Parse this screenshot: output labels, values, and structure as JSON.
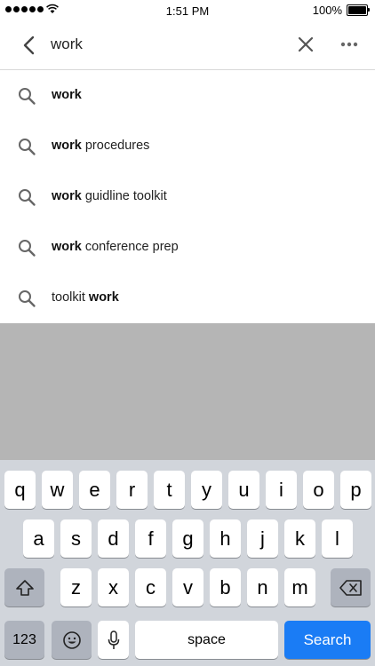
{
  "status": {
    "time": "1:51 PM",
    "battery": "100%"
  },
  "search": {
    "value": "work",
    "placeholder": ""
  },
  "icons": {
    "back": "chevron-left-icon",
    "clear": "close-icon",
    "more": "more-horizontal-icon",
    "suggestion": "search-icon"
  },
  "suggestions": [
    {
      "bold_pre": "work",
      "rest": "",
      "bold_post": ""
    },
    {
      "bold_pre": "work",
      "rest": " procedures",
      "bold_post": ""
    },
    {
      "bold_pre": "work",
      "rest": " guidline toolkit",
      "bold_post": ""
    },
    {
      "bold_pre": "work",
      "rest": " conference prep",
      "bold_post": ""
    },
    {
      "bold_pre": "",
      "rest": "toolkit ",
      "bold_post": "work"
    }
  ],
  "keyboard": {
    "row1": [
      "q",
      "w",
      "e",
      "r",
      "t",
      "y",
      "u",
      "i",
      "o",
      "p"
    ],
    "row2": [
      "a",
      "s",
      "d",
      "f",
      "g",
      "h",
      "j",
      "k",
      "l"
    ],
    "row3": [
      "z",
      "x",
      "c",
      "v",
      "b",
      "n",
      "m"
    ],
    "numbers_label": "123",
    "space_label": "space",
    "search_label": "Search"
  },
  "colors": {
    "accent": "#1a7cf5",
    "keyboard_bg": "#d1d5db",
    "dim_overlay": "#b5b5b5"
  }
}
